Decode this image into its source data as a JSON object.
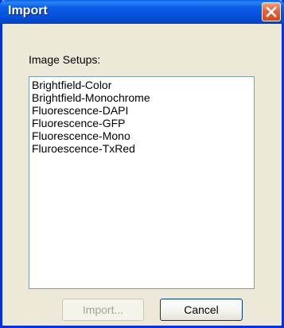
{
  "window": {
    "title": "Import"
  },
  "image_setups": {
    "label": "Image Setups:",
    "items": [
      "Brightfield-Color",
      "Brightfield-Monochrome",
      "Fluorescence-DAPI",
      "Fluorescence-GFP",
      "Fluorescence-Mono",
      "Fluroescence-TxRed"
    ]
  },
  "buttons": {
    "import_label": "Import...",
    "import_enabled": false,
    "cancel_label": "Cancel"
  },
  "colors": {
    "titlebar": "#0554df",
    "close_button": "#e3633c",
    "window_bg": "#ece9d8"
  }
}
